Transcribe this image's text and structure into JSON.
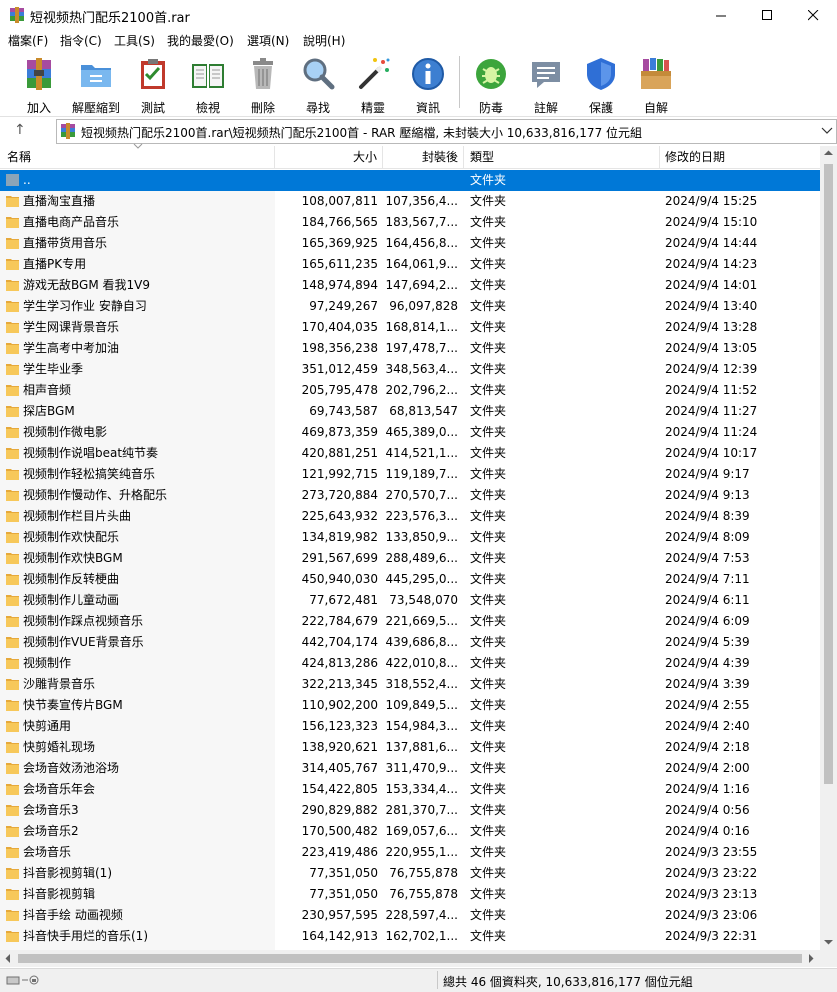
{
  "window": {
    "title": "短视频热门配乐2100首.rar",
    "minimize": "—",
    "maximize": "☐",
    "close": "✕"
  },
  "menu": [
    {
      "label": "檔案(F)"
    },
    {
      "label": "指令(C)"
    },
    {
      "label": "工具(S)"
    },
    {
      "label": "我的最愛(O)"
    },
    {
      "label": "選項(N)"
    },
    {
      "label": "說明(H)"
    }
  ],
  "toolbar": [
    {
      "label": "加入",
      "icon": "add-archive-icon"
    },
    {
      "label": "解壓縮到",
      "icon": "extract-folder-icon"
    },
    {
      "label": "測試",
      "icon": "test-clipboard-icon"
    },
    {
      "label": "檢視",
      "icon": "view-book-icon"
    },
    {
      "label": "刪除",
      "icon": "trash-icon"
    },
    {
      "label": "尋找",
      "icon": "magnifier-icon"
    },
    {
      "label": "精靈",
      "icon": "wizard-wand-icon"
    },
    {
      "label": "資訊",
      "icon": "info-icon"
    },
    {
      "label": "防毒",
      "icon": "antivirus-bug-icon"
    },
    {
      "label": "註解",
      "icon": "comment-icon"
    },
    {
      "label": "保護",
      "icon": "shield-icon"
    },
    {
      "label": "自解",
      "icon": "sfx-box-icon"
    }
  ],
  "address": {
    "up_glyph": "↑",
    "text": "短视频热门配乐2100首.rar\\短视频热门配乐2100首 - RAR 壓縮檔, 未封裝大小 10,633,816,177 位元組"
  },
  "columns": {
    "name": "名稱",
    "size": "大小",
    "packed": "封裝後",
    "type": "類型",
    "modified": "修改的日期"
  },
  "parent_row": {
    "name": "..",
    "type": "文件夹"
  },
  "files": [
    {
      "name": "直播淘宝直播",
      "size": "108,007,811",
      "packed": "107,356,4...",
      "type": "文件夹",
      "modified": "2024/9/4 15:25"
    },
    {
      "name": "直播电商产品音乐",
      "size": "184,766,565",
      "packed": "183,567,7...",
      "type": "文件夹",
      "modified": "2024/9/4 15:10"
    },
    {
      "name": "直播带货用音乐",
      "size": "165,369,925",
      "packed": "164,456,8...",
      "type": "文件夹",
      "modified": "2024/9/4 14:44"
    },
    {
      "name": "直播PK专用",
      "size": "165,611,235",
      "packed": "164,061,9...",
      "type": "文件夹",
      "modified": "2024/9/4 14:23"
    },
    {
      "name": "游戏无敌BGM 看我1V9",
      "size": "148,974,894",
      "packed": "147,694,2...",
      "type": "文件夹",
      "modified": "2024/9/4 14:01"
    },
    {
      "name": "学生学习作业 安静自习",
      "size": "97,249,267",
      "packed": "96,097,828",
      "type": "文件夹",
      "modified": "2024/9/4 13:40"
    },
    {
      "name": "学生网课背景音乐",
      "size": "170,404,035",
      "packed": "168,814,1...",
      "type": "文件夹",
      "modified": "2024/9/4 13:28"
    },
    {
      "name": "学生高考中考加油",
      "size": "198,356,238",
      "packed": "197,478,7...",
      "type": "文件夹",
      "modified": "2024/9/4 13:05"
    },
    {
      "name": "学生毕业季",
      "size": "351,012,459",
      "packed": "348,563,4...",
      "type": "文件夹",
      "modified": "2024/9/4 12:39"
    },
    {
      "name": "相声音频",
      "size": "205,795,478",
      "packed": "202,796,2...",
      "type": "文件夹",
      "modified": "2024/9/4 11:52"
    },
    {
      "name": "探店BGM",
      "size": "69,743,587",
      "packed": "68,813,547",
      "type": "文件夹",
      "modified": "2024/9/4 11:27"
    },
    {
      "name": "视频制作微电影",
      "size": "469,873,359",
      "packed": "465,389,0...",
      "type": "文件夹",
      "modified": "2024/9/4 11:24"
    },
    {
      "name": "视频制作说唱beat纯节奏",
      "size": "420,881,251",
      "packed": "414,521,1...",
      "type": "文件夹",
      "modified": "2024/9/4 10:17"
    },
    {
      "name": "视频制作轻松搞笑纯音乐",
      "size": "121,992,715",
      "packed": "119,189,7...",
      "type": "文件夹",
      "modified": "2024/9/4 9:17"
    },
    {
      "name": "视频制作慢动作、升格配乐",
      "size": "273,720,884",
      "packed": "270,570,7...",
      "type": "文件夹",
      "modified": "2024/9/4 9:13"
    },
    {
      "name": "视频制作栏目片头曲",
      "size": "225,643,932",
      "packed": "223,576,3...",
      "type": "文件夹",
      "modified": "2024/9/4 8:39"
    },
    {
      "name": "视频制作欢快配乐",
      "size": "134,819,982",
      "packed": "133,850,9...",
      "type": "文件夹",
      "modified": "2024/9/4 8:09"
    },
    {
      "name": "视频制作欢快BGM",
      "size": "291,567,699",
      "packed": "288,489,6...",
      "type": "文件夹",
      "modified": "2024/9/4 7:53"
    },
    {
      "name": "视频制作反转梗曲",
      "size": "450,940,030",
      "packed": "445,295,0...",
      "type": "文件夹",
      "modified": "2024/9/4 7:11"
    },
    {
      "name": "视频制作儿童动画",
      "size": "77,672,481",
      "packed": "73,548,070",
      "type": "文件夹",
      "modified": "2024/9/4 6:11"
    },
    {
      "name": "视频制作踩点视频音乐",
      "size": "222,784,679",
      "packed": "221,669,5...",
      "type": "文件夹",
      "modified": "2024/9/4 6:09"
    },
    {
      "name": "视频制作VUE背景音乐",
      "size": "442,704,174",
      "packed": "439,686,8...",
      "type": "文件夹",
      "modified": "2024/9/4 5:39"
    },
    {
      "name": "视频制作",
      "size": "424,813,286",
      "packed": "422,010,8...",
      "type": "文件夹",
      "modified": "2024/9/4 4:39"
    },
    {
      "name": "沙雕背景音乐",
      "size": "322,213,345",
      "packed": "318,552,4...",
      "type": "文件夹",
      "modified": "2024/9/4 3:39"
    },
    {
      "name": "快节奏宣传片BGM",
      "size": "110,902,200",
      "packed": "109,849,5...",
      "type": "文件夹",
      "modified": "2024/9/4 2:55"
    },
    {
      "name": "快剪通用",
      "size": "156,123,323",
      "packed": "154,984,3...",
      "type": "文件夹",
      "modified": "2024/9/4 2:40"
    },
    {
      "name": "快剪婚礼现场",
      "size": "138,920,621",
      "packed": "137,881,6...",
      "type": "文件夹",
      "modified": "2024/9/4 2:18"
    },
    {
      "name": "会场音效汤池浴场",
      "size": "314,405,767",
      "packed": "311,470,9...",
      "type": "文件夹",
      "modified": "2024/9/4 2:00"
    },
    {
      "name": "会场音乐年会",
      "size": "154,422,805",
      "packed": "153,334,4...",
      "type": "文件夹",
      "modified": "2024/9/4 1:16"
    },
    {
      "name": "会场音乐3",
      "size": "290,829,882",
      "packed": "281,370,7...",
      "type": "文件夹",
      "modified": "2024/9/4 0:56"
    },
    {
      "name": "会场音乐2",
      "size": "170,500,482",
      "packed": "169,057,6...",
      "type": "文件夹",
      "modified": "2024/9/4 0:16"
    },
    {
      "name": "会场音乐",
      "size": "223,419,486",
      "packed": "220,955,1...",
      "type": "文件夹",
      "modified": "2024/9/3 23:55"
    },
    {
      "name": "抖音影视剪辑(1)",
      "size": "77,351,050",
      "packed": "76,755,878",
      "type": "文件夹",
      "modified": "2024/9/3 23:22"
    },
    {
      "name": "抖音影视剪辑",
      "size": "77,351,050",
      "packed": "76,755,878",
      "type": "文件夹",
      "modified": "2024/9/3 23:13"
    },
    {
      "name": "抖音手绘 动画视频",
      "size": "230,957,595",
      "packed": "228,597,4...",
      "type": "文件夹",
      "modified": "2024/9/3 23:06"
    },
    {
      "name": "抖音快手用烂的音乐(1)",
      "size": "164,142,913",
      "packed": "162,702,1...",
      "type": "文件夹",
      "modified": "2024/9/3 22:31"
    }
  ],
  "status": {
    "text": "總共 46 個資料夾, 10,633,816,177 個位元組"
  },
  "colors": {
    "selection": "#0078d7",
    "folder": "#f7c85a",
    "folder_tab": "#e6a93b"
  }
}
